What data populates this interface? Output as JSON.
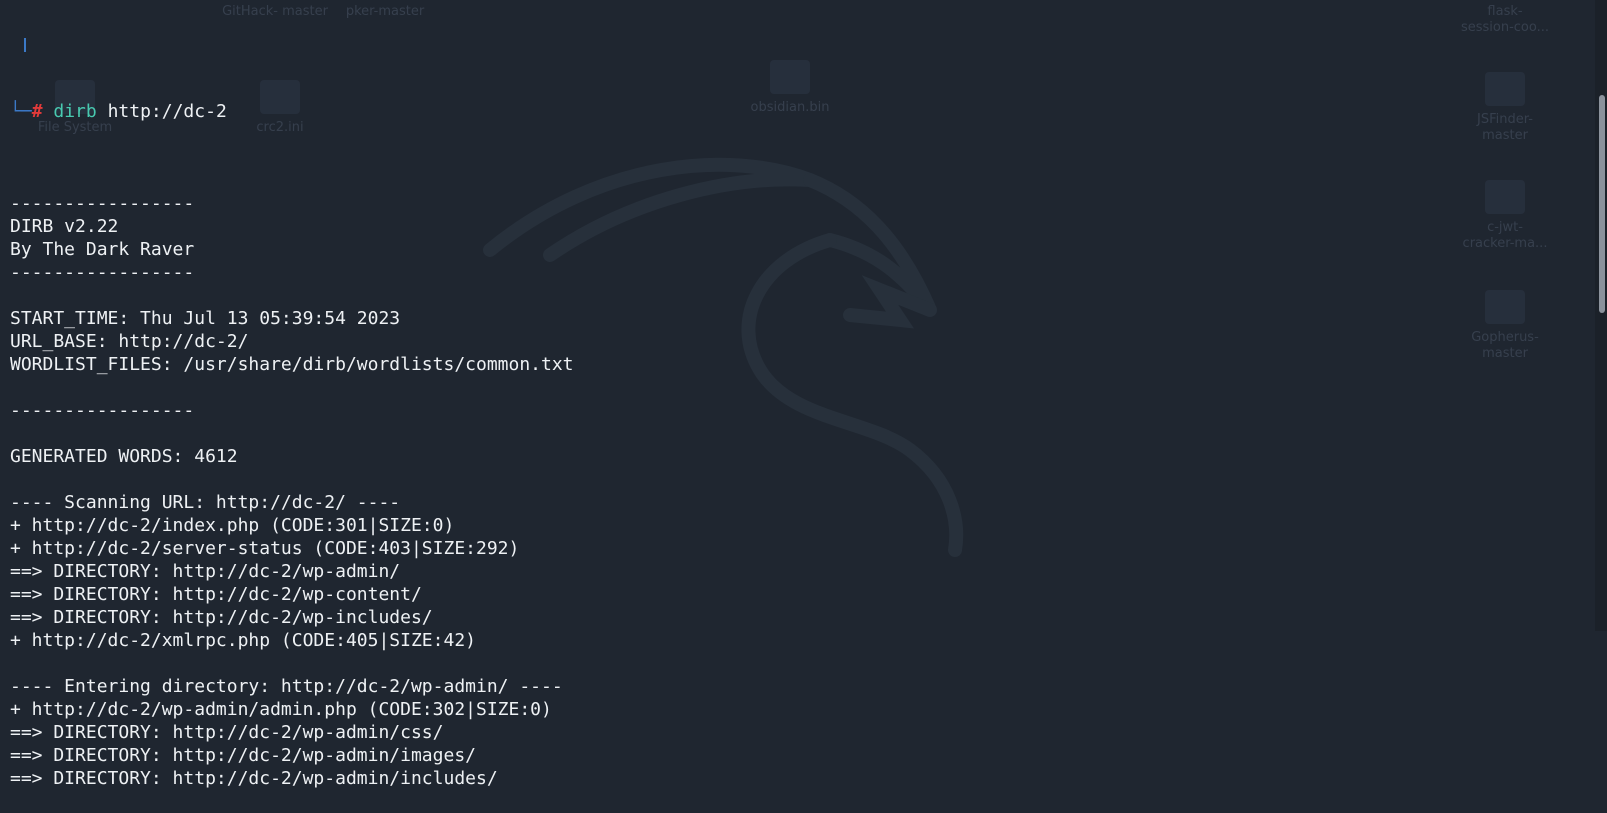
{
  "desktop": {
    "icons": [
      {
        "label": "GitHack-\nmaster"
      },
      {
        "label": "pker-master"
      },
      {
        "label": "File System"
      },
      {
        "label": "crc2.ini"
      },
      {
        "label": "obsidian.bin"
      },
      {
        "label": "flask-\nsession-coo..."
      },
      {
        "label": "JSFinder-\nmaster"
      },
      {
        "label": "c-jwt-\ncracker-ma..."
      },
      {
        "label": "Gopherus-\nmaster"
      }
    ]
  },
  "terminal": {
    "prompt": {
      "corner": "└─",
      "symbol": "#",
      "command": "dirb",
      "argument": " http://dc-2"
    },
    "output": [
      "",
      "-----------------",
      "DIRB v2.22",
      "By The Dark Raver",
      "-----------------",
      "",
      "START_TIME: Thu Jul 13 05:39:54 2023",
      "URL_BASE: http://dc-2/",
      "WORDLIST_FILES: /usr/share/dirb/wordlists/common.txt",
      "",
      "-----------------",
      "",
      "GENERATED WORDS: 4612",
      "",
      "---- Scanning URL: http://dc-2/ ----",
      "+ http://dc-2/index.php (CODE:301|SIZE:0)",
      "+ http://dc-2/server-status (CODE:403|SIZE:292)",
      "==> DIRECTORY: http://dc-2/wp-admin/",
      "==> DIRECTORY: http://dc-2/wp-content/",
      "==> DIRECTORY: http://dc-2/wp-includes/",
      "+ http://dc-2/xmlrpc.php (CODE:405|SIZE:42)",
      "",
      "---- Entering directory: http://dc-2/wp-admin/ ----",
      "+ http://dc-2/wp-admin/admin.php (CODE:302|SIZE:0)",
      "==> DIRECTORY: http://dc-2/wp-admin/css/",
      "==> DIRECTORY: http://dc-2/wp-admin/images/",
      "==> DIRECTORY: http://dc-2/wp-admin/includes/"
    ]
  },
  "colors": {
    "background": "#1f2630",
    "text": "#eef1f4",
    "prompt_hash": "#e23a3a",
    "command": "#48c9b0",
    "prompt_line": "#3b79c7"
  },
  "icons": [
    "dragon-logo-icon",
    "file-icon",
    "folder-icon"
  ]
}
